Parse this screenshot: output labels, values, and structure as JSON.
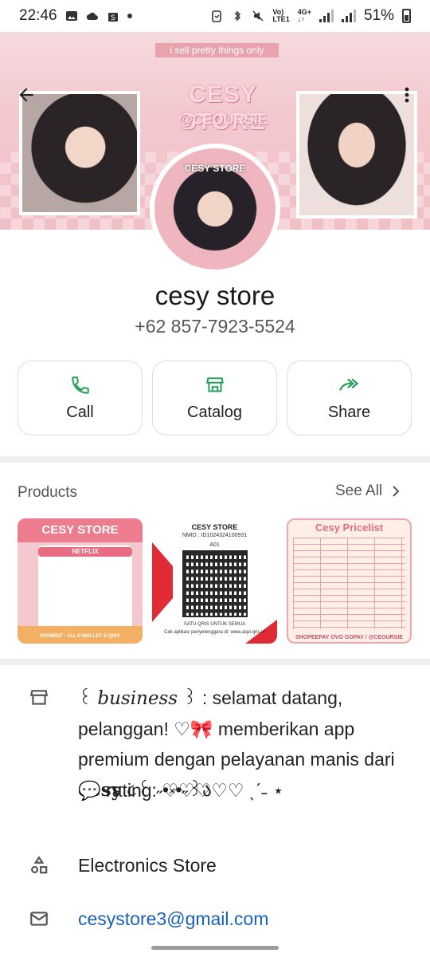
{
  "status_bar": {
    "time": "22:46",
    "network_top": "Vo)",
    "network_bottom": "LTE1",
    "network2_top": "4G+",
    "network2_bottom": "↓↑",
    "battery": "51%"
  },
  "header": {
    "tagline": "i sell pretty things only",
    "brand": "CESY STORE",
    "handle": "@CEOURSIE",
    "avatar_caption": "CESY STORE"
  },
  "profile": {
    "name": "cesy store",
    "phone": "+62 857-7923-5524"
  },
  "actions": [
    {
      "label": "Call",
      "icon": "phone-icon"
    },
    {
      "label": "Catalog",
      "icon": "storefront-icon"
    },
    {
      "label": "Share",
      "icon": "forward-icon"
    }
  ],
  "products": {
    "title": "Products",
    "see_all": "See All",
    "items": [
      {
        "title": "CESY STORE",
        "subtitle": "NETFLIX",
        "footer": "PAYMENT : ALL E-WALLET & QRIS"
      },
      {
        "title": "CESY STORE",
        "nmid": "NMID : ID1024324100931",
        "code": "A01",
        "caption": "SATU QRIS UNTUK SEMUA",
        "caption2": "Cek aplikasi penyelenggara di: www.aspi-qris.id"
      },
      {
        "title": "Cesy Pricelist",
        "footer": "SHOPEEPAY OVO GOPAY / @CEOURSIE"
      }
    ]
  },
  "about": {
    "description_part1": "꒰ ",
    "description_italic": "business",
    "description_part2": " ꒱ : selamat datang, pelanggan! ♡🎀 memberikan app premium dengan pelayanan manis dari ",
    "description_bold": "cesy",
    "description_part3": " ૮꒰ ˶•༝•˶꒱ა",
    "rating": "💬 rating: ♡♡♡♡♡ ˎˊ˗ ⋆",
    "category": "Electronics Store",
    "email": "cesystore3@gmail.com"
  },
  "colors": {
    "accent_green": "#1f9d55",
    "link_blue": "#1a62b8",
    "banner_pink": "#f3c9cf"
  }
}
